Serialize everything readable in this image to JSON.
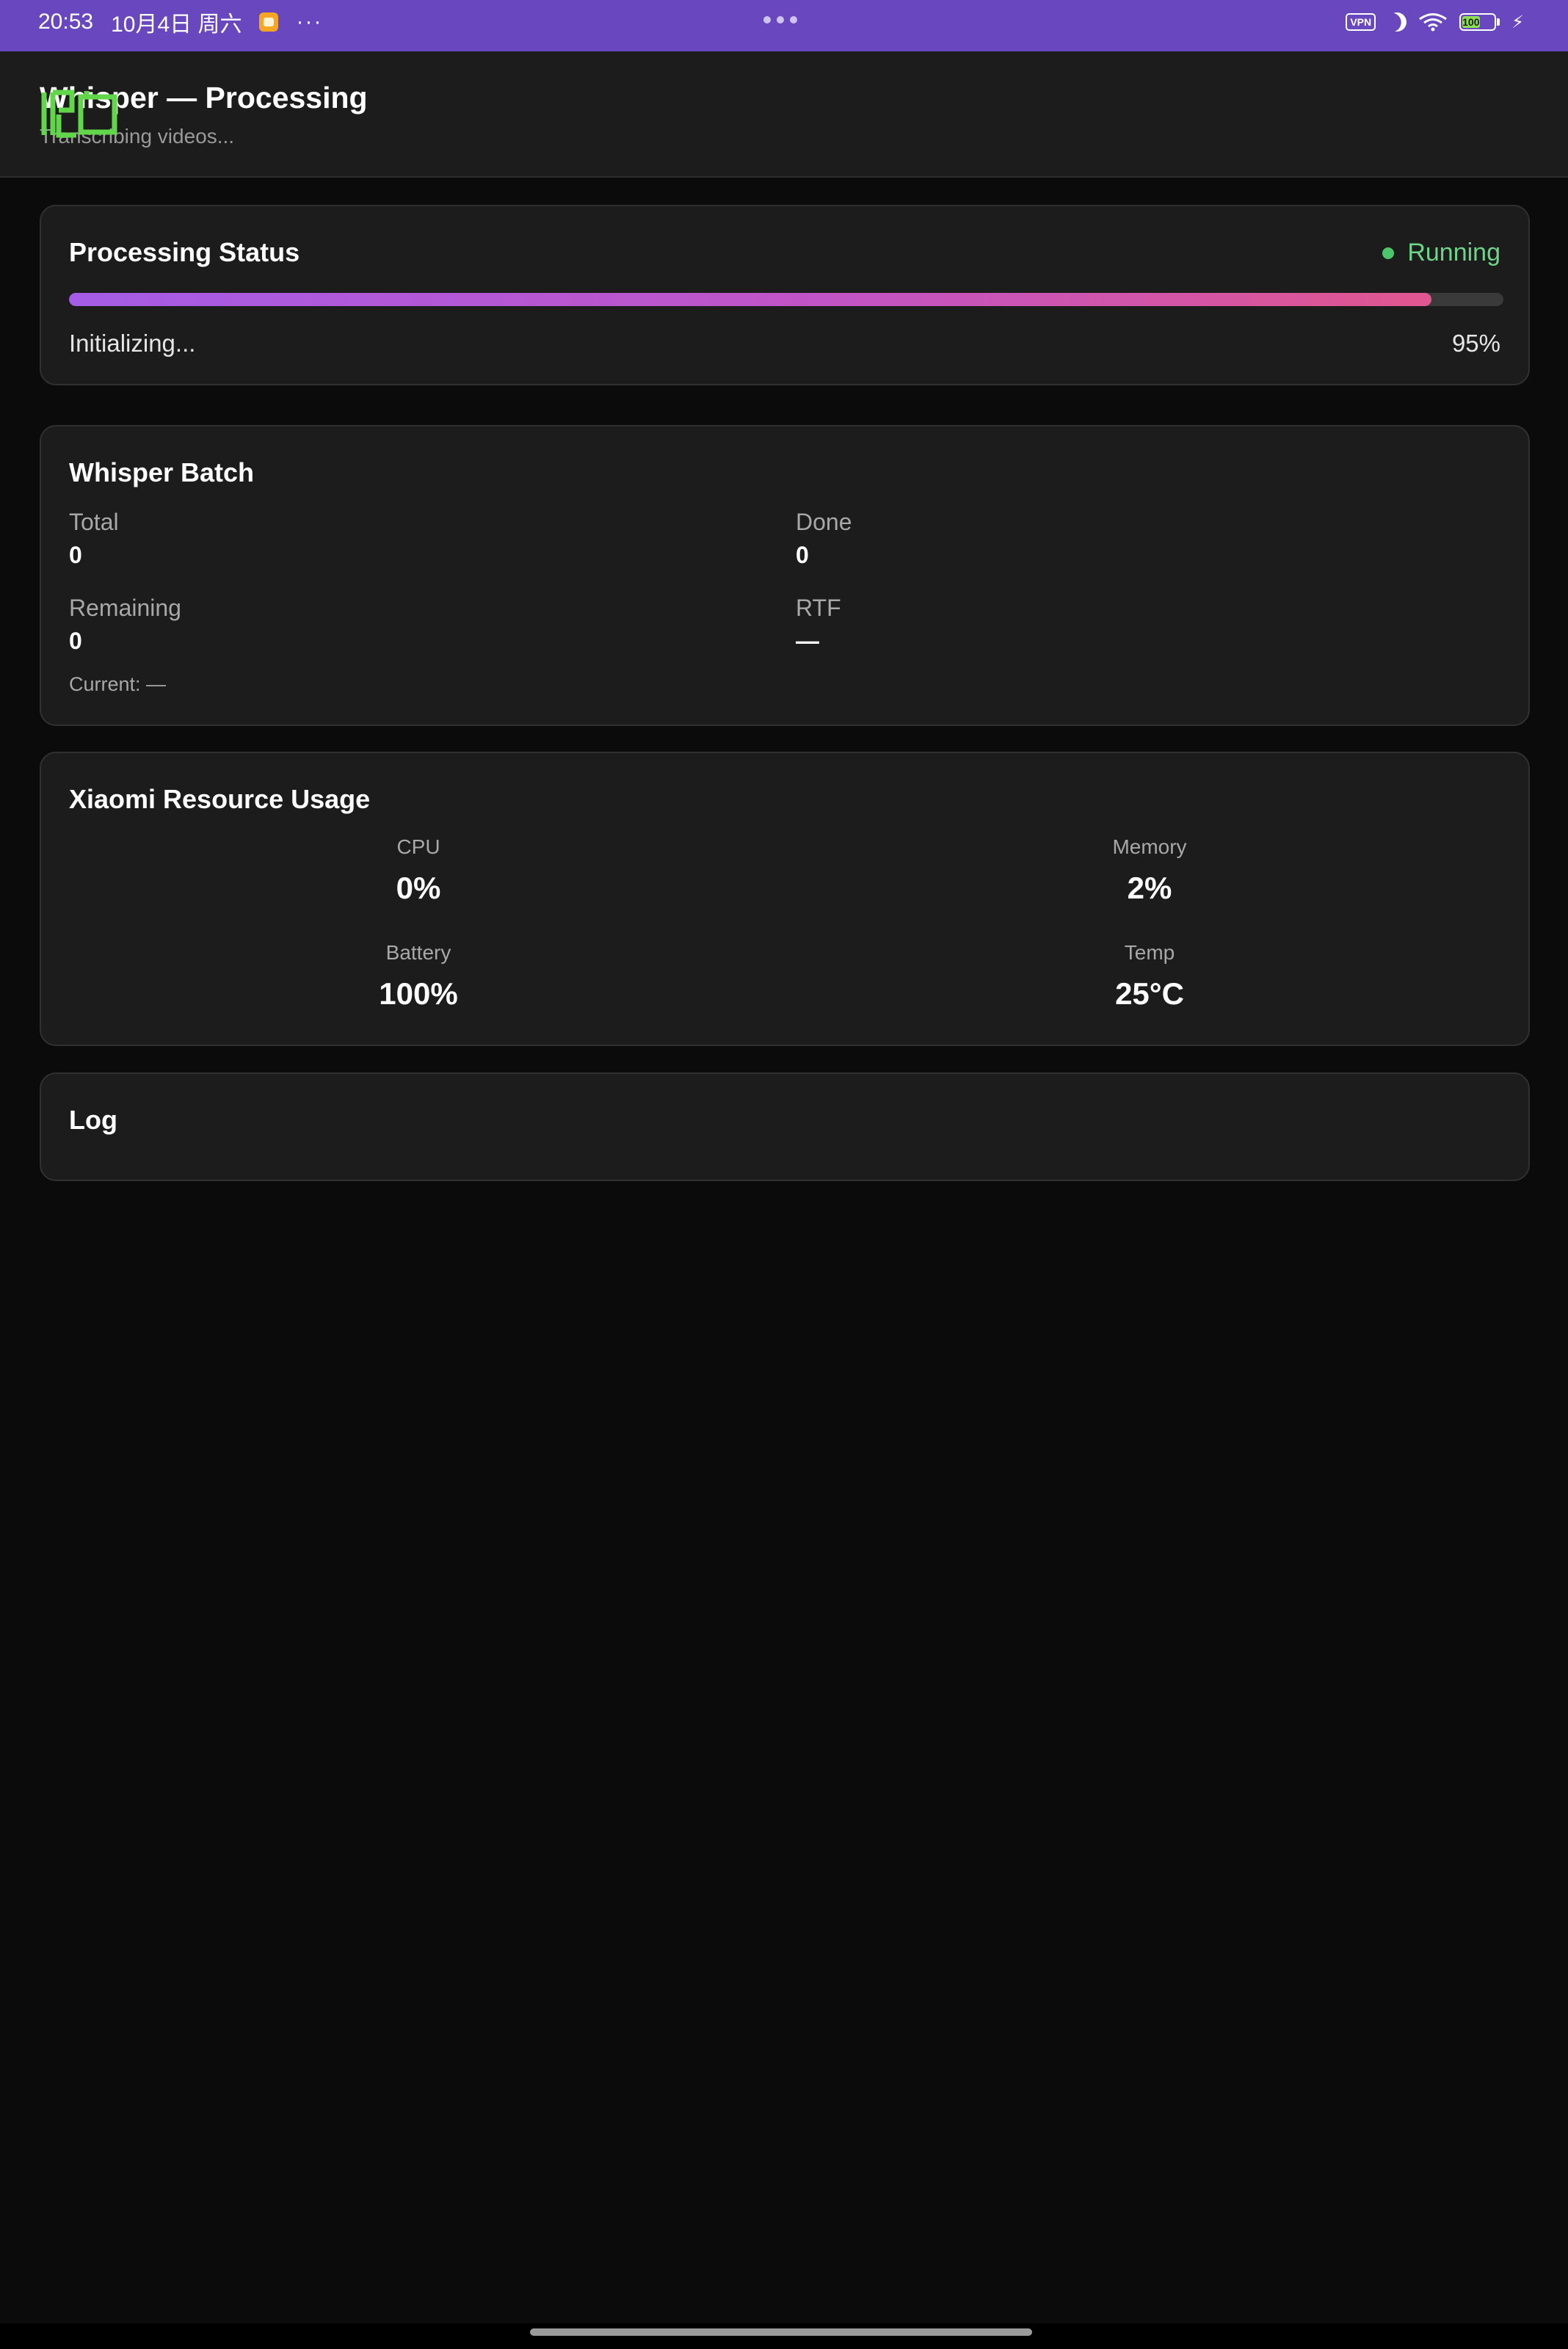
{
  "status_bar": {
    "time": "20:53",
    "date": "10月4日 周六",
    "more": "···",
    "vpn": "VPN",
    "battery_level": "100",
    "icons": [
      "notification-app-icon",
      "vpn-icon",
      "moon-icon",
      "wifi-icon",
      "battery-icon",
      "charging-icon"
    ]
  },
  "header": {
    "title": "Whisper — Processing",
    "subtitle": "Transcribing videos..."
  },
  "processing_status": {
    "title": "Processing Status",
    "state": "Running",
    "message": "Initializing...",
    "percent_label": "95%",
    "progress": 0.95
  },
  "batch": {
    "title": "Whisper Batch",
    "total_label": "Total",
    "total_value": "0",
    "done_label": "Done",
    "done_value": "0",
    "remaining_label": "Remaining",
    "remaining_value": "0",
    "rtf_label": "RTF",
    "rtf_value": "—",
    "current": "Current: —"
  },
  "resources": {
    "title": "Xiaomi Resource Usage",
    "cpu_label": "CPU",
    "cpu_value": "0%",
    "memory_label": "Memory",
    "memory_value": "2%",
    "battery_label": "Battery",
    "battery_value": "100%",
    "temp_label": "Temp",
    "temp_value": "25°C"
  },
  "log": {
    "title": "Log"
  },
  "colors": {
    "status_bar": "#6847bf",
    "running": "#6ed487",
    "progress_start": "#a55ce6",
    "progress_end": "#e0568f"
  }
}
